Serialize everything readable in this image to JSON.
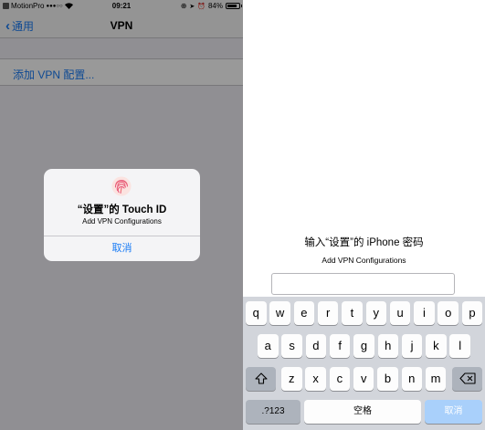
{
  "left": {
    "status_bar": {
      "carrier": "MotionPro",
      "signal": "●●●○○",
      "time": "09:21",
      "battery": "84%",
      "battery_level": 0.84
    },
    "nav": {
      "back_label": "通用",
      "title": "VPN"
    },
    "cell": {
      "label": "添加 VPN 配置..."
    },
    "alert": {
      "icon": "fingerprint-icon",
      "title": "“设置”的 Touch ID",
      "message": "Add VPN Configurations",
      "cancel_label": "取消"
    }
  },
  "right": {
    "prompt_title": "输入“设置”的 iPhone 密码",
    "prompt_message": "Add VPN Configurations",
    "password_value": "",
    "keyboard": {
      "row1": [
        "q",
        "w",
        "e",
        "r",
        "t",
        "y",
        "u",
        "i",
        "o",
        "p"
      ],
      "row2": [
        "a",
        "s",
        "d",
        "f",
        "g",
        "h",
        "j",
        "k",
        "l"
      ],
      "row3": [
        "z",
        "x",
        "c",
        "v",
        "b",
        "n",
        "m"
      ],
      "shift_icon": "shift-icon",
      "delete_icon": "backspace-icon",
      "numbers_label": ".?123",
      "space_label": "空格",
      "cancel_label": "取消"
    }
  },
  "colors": {
    "accent": "#1a7cf5",
    "keyboard_bg": "#d2d5db",
    "function_key": "#adb3bc",
    "done_key": "#a9d0fb"
  }
}
